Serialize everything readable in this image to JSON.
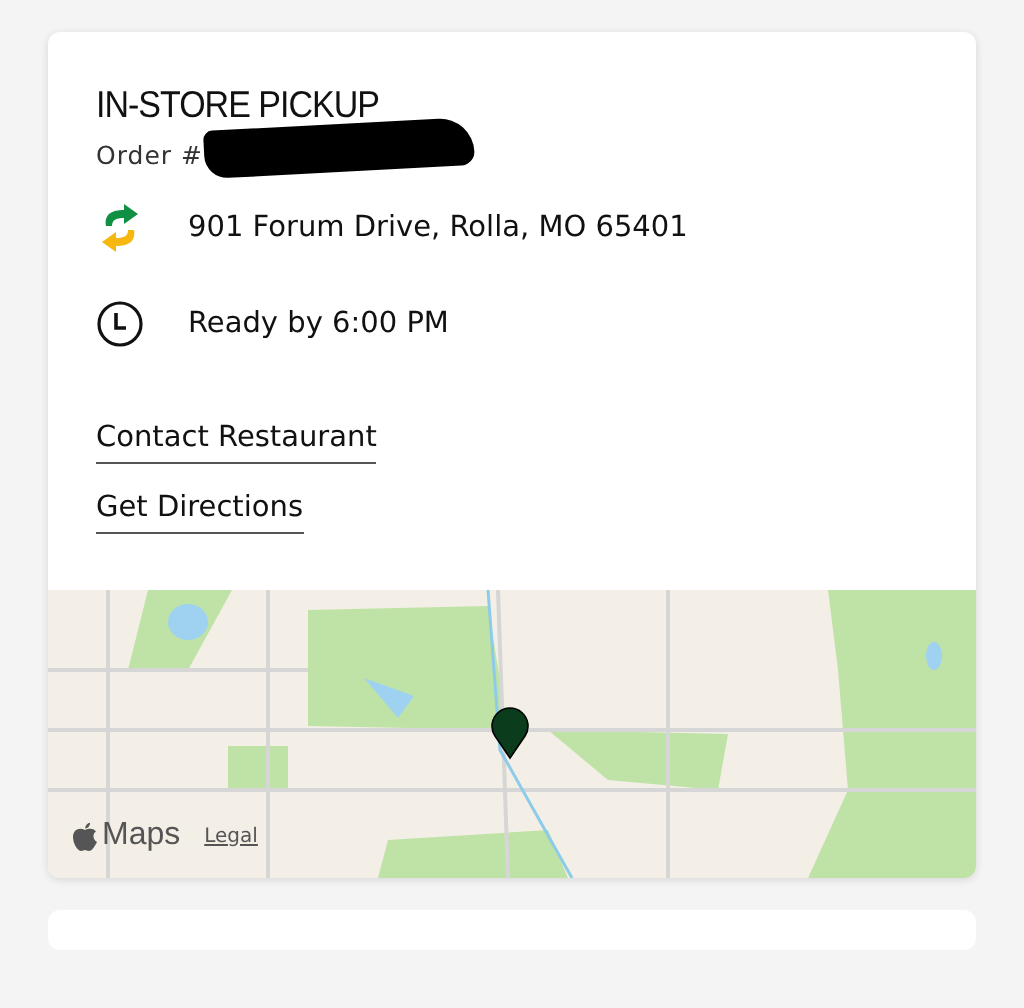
{
  "pickup": {
    "title": "IN-STORE PICKUP",
    "order_label": "Order #",
    "order_redacted": true
  },
  "details": [
    {
      "kind": "store",
      "text": "901 Forum Drive, Rolla, MO 65401"
    },
    {
      "kind": "time",
      "text": "Ready by 6:00 PM"
    }
  ],
  "links": [
    "Contact Restaurant",
    "Get Directions"
  ],
  "map": {
    "kind": "picture",
    "attribution": "Maps",
    "legal": "Legal"
  }
}
